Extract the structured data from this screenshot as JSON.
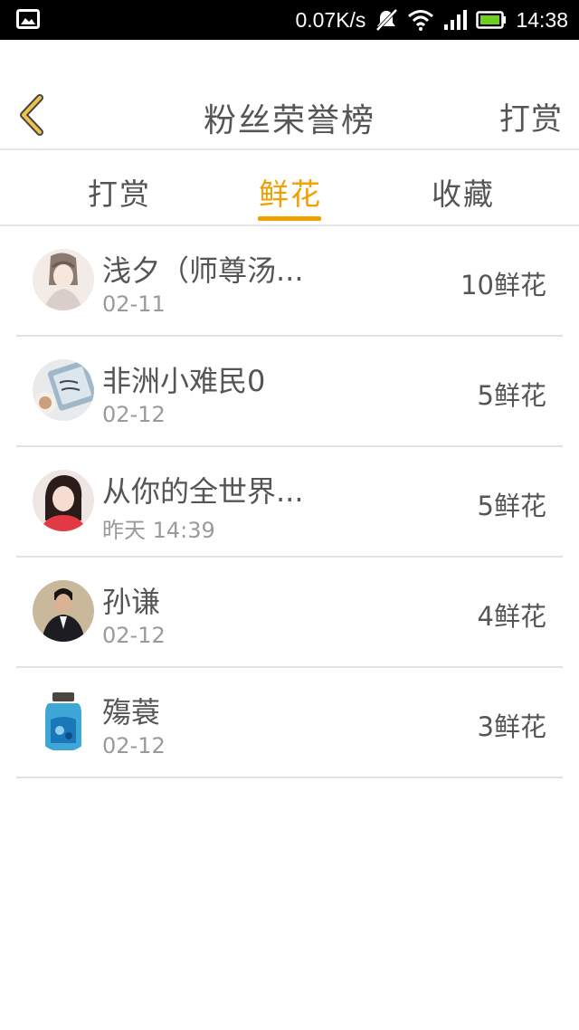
{
  "status_bar": {
    "network_speed": "0.07K/s",
    "time": "14:38",
    "icons": [
      "gallery-icon",
      "mute-icon",
      "wifi-icon",
      "signal-icon",
      "battery-icon"
    ]
  },
  "header": {
    "title": "粉丝荣誉榜",
    "action_label": "打赏",
    "back_icon": "chevron-left-icon",
    "accent_color": "#f0c24a"
  },
  "tabs": [
    {
      "label": "打赏",
      "active": false
    },
    {
      "label": "鲜花",
      "active": true
    },
    {
      "label": "收藏",
      "active": false
    }
  ],
  "active_tab_color": "#f0a000",
  "rows": [
    {
      "name": "浅夕（师尊汤...",
      "date": "02-11",
      "amount": "10鲜花"
    },
    {
      "name": "非洲小难民0",
      "date": "02-12",
      "amount": "5鲜花"
    },
    {
      "name": "从你的全世界...",
      "date": "昨天 14:39",
      "amount": "5鲜花"
    },
    {
      "name": "孙谦",
      "date": "02-12",
      "amount": "4鲜花"
    },
    {
      "name": "殤蓑",
      "date": "02-12",
      "amount": "3鲜花"
    }
  ]
}
